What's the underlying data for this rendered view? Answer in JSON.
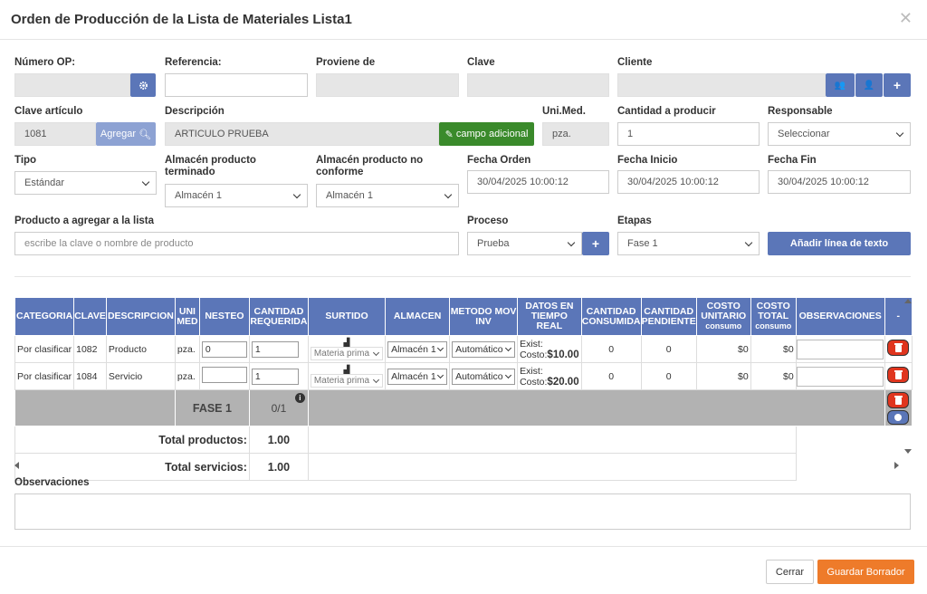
{
  "dialog": {
    "title": "Orden de Producción de la Lista de Materiales Lista1"
  },
  "form": {
    "numero_op": {
      "label": "Número OP:",
      "value": ""
    },
    "referencia": {
      "label": "Referencia:",
      "value": ""
    },
    "proviene": {
      "label": "Proviene de",
      "value": ""
    },
    "clave": {
      "label": "Clave",
      "value": ""
    },
    "cliente": {
      "label": "Cliente",
      "value": ""
    },
    "clave_articulo": {
      "label": "Clave artículo",
      "value": "1081",
      "btn": "Agregar"
    },
    "descripcion": {
      "label": "Descripción",
      "value": "ARTICULO PRUEBA",
      "btn": "campo adicional"
    },
    "unimed": {
      "label": "Uni.Med.",
      "value": "pza."
    },
    "cantidad": {
      "label": "Cantidad a producir",
      "value": "1"
    },
    "responsable": {
      "label": "Responsable",
      "value": "Seleccionar"
    },
    "tipo": {
      "label": "Tipo",
      "value": "Estándar"
    },
    "alm_term": {
      "label1": "Almacén producto",
      "label2": "terminado",
      "value": "Almacén 1"
    },
    "alm_noconf": {
      "label1": "Almacén producto no",
      "label2": "conforme",
      "value": "Almacén 1"
    },
    "fecha_orden": {
      "label": "Fecha Orden",
      "value": "30/04/2025 10:00:12"
    },
    "fecha_inicio": {
      "label": "Fecha Inicio",
      "value": "30/04/2025 10:00:12"
    },
    "fecha_fin": {
      "label": "Fecha Fin",
      "value": "30/04/2025 10:00:12"
    },
    "producto": {
      "label": "Producto a agregar a la lista",
      "placeholder": "escribe la clave o nombre de producto"
    },
    "proceso": {
      "label": "Proceso",
      "value": "Prueba"
    },
    "etapas": {
      "label": "Etapas",
      "value": "Fase 1"
    },
    "add_line_btn": "Añadir línea de texto"
  },
  "table": {
    "headers": {
      "categoria": "CATEGORIA",
      "clave": "CLAVE",
      "descripcion": "DESCRIPCION",
      "unimed1": "UNI",
      "unimed2": "MED",
      "nesteo": "NESTEO",
      "cant_req1": "CANTIDAD",
      "cant_req2": "REQUERIDA",
      "surtido": "SURTIDO",
      "almacen": "ALMACEN",
      "metodo1": "METODO MOV",
      "metodo2": "INV",
      "datos1": "DATOS EN",
      "datos2": "TIEMPO",
      "datos3": "REAL",
      "cant_cons1": "CANTIDAD",
      "cant_cons2": "CONSUMIDA",
      "cant_pend1": "CANTIDAD",
      "cant_pend2": "PENDIENTE",
      "costo_u1": "COSTO",
      "costo_u2": "UNITARIO",
      "costo_u3": "consumo",
      "costo_t1": "COSTO",
      "costo_t2": "TOTAL",
      "costo_t3": "consumo",
      "observaciones": "OBSERVACIONES",
      "dash": "-"
    },
    "rows": [
      {
        "categoria": "Por clasificar",
        "clave": "1082",
        "descripcion": "Producto",
        "unimed": "pza.",
        "nesteo": "0",
        "cantidad": "1",
        "surtido": "Materia prima",
        "almacen": "Almacén 1",
        "metodo": "Automático",
        "exist": "Exist:",
        "costo_label": "Costo:",
        "costo": "$10.00",
        "consumida": "0",
        "pendiente": "0",
        "costo_unit": "$0",
        "costo_total": "$0"
      },
      {
        "categoria": "Por clasificar",
        "clave": "1084",
        "descripcion": "Servicio",
        "unimed": "pza.",
        "nesteo": "",
        "cantidad": "1",
        "surtido": "Materia prima",
        "almacen": "Almacén 1",
        "metodo": "Automático",
        "exist": "Exist:",
        "costo_label": "Costo:",
        "costo": "$20.00",
        "consumida": "0",
        "pendiente": "0",
        "costo_unit": "$0",
        "costo_total": "$0"
      }
    ],
    "fase": {
      "name": "FASE 1",
      "count": "0/1"
    },
    "totals": [
      {
        "label": "Total productos:",
        "value": "1.00"
      },
      {
        "label": "Total servicios:",
        "value": "1.00"
      }
    ]
  },
  "observaciones": {
    "label": "Observaciones",
    "value": ""
  },
  "footer": {
    "cancel": "Cerrar",
    "save": "Guardar Borrador"
  },
  "colors": {
    "primary": "#5b76b8",
    "green": "#3a8a2b",
    "orange": "#ee7b2a",
    "danger": "#e0351e"
  }
}
